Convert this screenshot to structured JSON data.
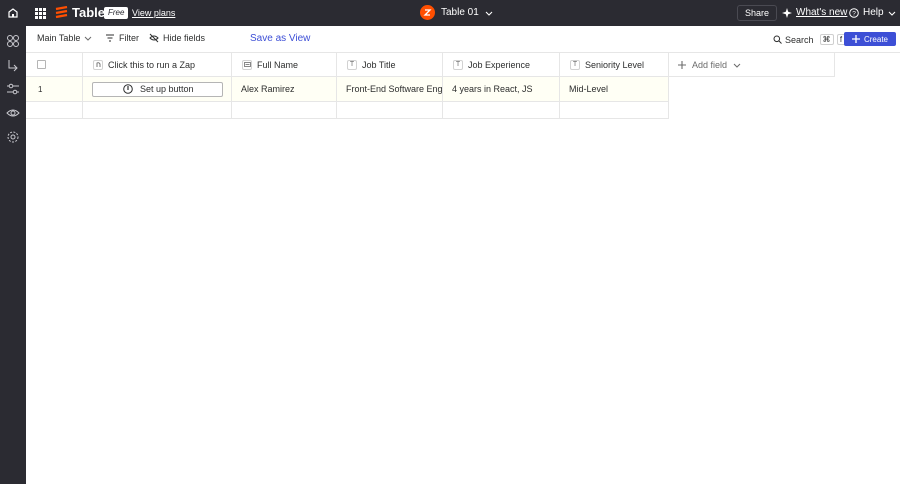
{
  "topbar": {
    "brand_name": "Tables",
    "plan_badge": "Free",
    "view_plans_label": "View plans",
    "table_name": "Table 01",
    "share_label": "Share",
    "whats_new_label": "What's new",
    "help_label": "Help"
  },
  "toolbar": {
    "view_selector_label": "Main Table",
    "filter_label": "Filter",
    "hide_fields_label": "Hide fields",
    "save_view_label": "Save as View",
    "search_label": "Search",
    "search_shortcut_mod": "⌘",
    "search_shortcut_key": "f",
    "create_label": "Create"
  },
  "grid": {
    "columns": [
      {
        "label": "Click this to run a Zap",
        "type_icon": "zap-button-icon"
      },
      {
        "label": "Full Name",
        "type_icon": "name-icon"
      },
      {
        "label": "Job Title",
        "type_icon": "text-icon"
      },
      {
        "label": "Job Experience",
        "type_icon": "text-icon"
      },
      {
        "label": "Seniority Level",
        "type_icon": "text-icon"
      }
    ],
    "add_field_label": "Add field",
    "rows": [
      {
        "number": "1",
        "zap_button_label": "Set up button",
        "full_name": "Alex Ramirez",
        "job_title": "Front-End Software Engineer",
        "job_experience": "4 years in React, JS",
        "seniority_level": "Mid-Level"
      }
    ]
  },
  "colors": {
    "chrome_bg": "#2b2b32",
    "accent": "#3d4fd6",
    "brand_orange": "#ff4f00",
    "row_highlight": "#fffff5"
  }
}
